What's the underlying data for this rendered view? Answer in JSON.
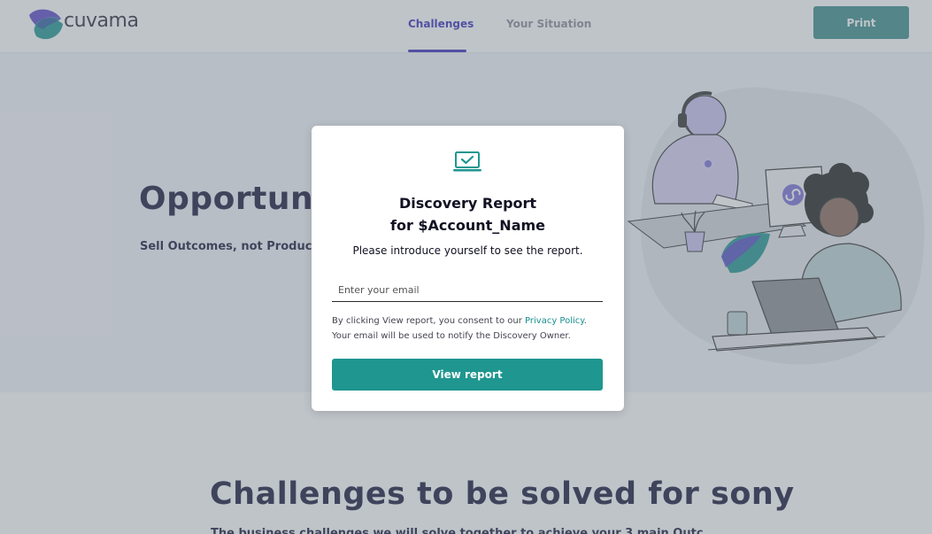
{
  "header": {
    "brand": "cuvama",
    "tabs": [
      {
        "label": "Challenges",
        "active": true
      },
      {
        "label": "Your Situation",
        "active": false
      }
    ],
    "print_label": "Print"
  },
  "hero": {
    "title": "Opportunit",
    "subtitle": "Sell Outcomes, not Products"
  },
  "section": {
    "title": "Challenges to be solved for sony",
    "subtitle": "The business challenges we will solve together to achieve your 3 main Outc"
  },
  "modal": {
    "icon": "laptop-check-icon",
    "title_line1": "Discovery Report",
    "title_line2": "for $Account_Name",
    "description": "Please introduce yourself to see the report.",
    "email_placeholder": "Enter your email",
    "consent_prefix": "By clicking View report, you consent to our ",
    "privacy_link": "Privacy Policy",
    "consent_suffix": ".",
    "notify_text": "Your email will be used to notify the Discovery Owner.",
    "view_button": "View report"
  },
  "colors": {
    "brand_purple": "#3a2fb8",
    "teal_button": "#1f9690",
    "print_button": "#3b8d8a",
    "heading": "#16163a"
  }
}
